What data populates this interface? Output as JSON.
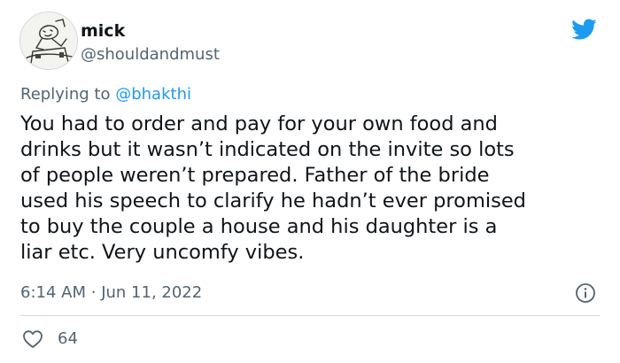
{
  "author": {
    "name": "mick",
    "handle": "@shouldandmust",
    "avatar_icon": "sketch-avatar"
  },
  "platform_icon": "twitter-bird-icon",
  "brand_color": "#1d9bf0",
  "reply_context": {
    "prefix": "Replying to",
    "handle": "@bhakthi"
  },
  "body_lines": [
    "You had to order and pay for your own food and",
    "drinks but it wasn’t indicated on the invite so lots",
    "of people weren’t prepared. Father of the bride",
    "used his speech to clarify he hadn’t ever promised",
    "to buy the couple a house and his daughter is a",
    "liar etc. Very uncomfy vibes."
  ],
  "meta": {
    "time": "6:14 AM",
    "separator": "·",
    "date": "Jun 11, 2022"
  },
  "actions": {
    "like_icon": "heart-outline-icon",
    "like_count": "64",
    "info_icon": "info-circle-icon"
  }
}
